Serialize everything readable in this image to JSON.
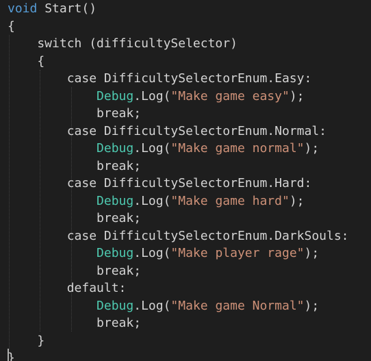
{
  "editor": {
    "lines": [
      {
        "tokens": [
          {
            "t": "void",
            "c": "kw"
          },
          {
            "t": " ",
            "c": "plain"
          },
          {
            "t": "Start",
            "c": "plain"
          },
          {
            "t": "()",
            "c": "plain"
          }
        ]
      },
      {
        "tokens": [
          {
            "t": "{",
            "c": "plain"
          }
        ]
      },
      {
        "tokens": [
          {
            "t": "    switch (difficultySelector)",
            "c": "plain"
          }
        ]
      },
      {
        "tokens": [
          {
            "t": "    {",
            "c": "plain"
          }
        ]
      },
      {
        "tokens": [
          {
            "t": "        case DifficultySelectorEnum.Easy:",
            "c": "plain"
          }
        ]
      },
      {
        "tokens": [
          {
            "t": "            ",
            "c": "plain"
          },
          {
            "t": "Debug",
            "c": "type"
          },
          {
            "t": ".Log(",
            "c": "plain"
          },
          {
            "t": "\"Make game easy\"",
            "c": "str"
          },
          {
            "t": ");",
            "c": "plain"
          }
        ]
      },
      {
        "tokens": [
          {
            "t": "            break;",
            "c": "plain"
          }
        ]
      },
      {
        "tokens": [
          {
            "t": "        case DifficultySelectorEnum.Normal:",
            "c": "plain"
          }
        ]
      },
      {
        "tokens": [
          {
            "t": "            ",
            "c": "plain"
          },
          {
            "t": "Debug",
            "c": "type"
          },
          {
            "t": ".Log(",
            "c": "plain"
          },
          {
            "t": "\"Make game normal\"",
            "c": "str"
          },
          {
            "t": ");",
            "c": "plain"
          }
        ]
      },
      {
        "tokens": [
          {
            "t": "            break;",
            "c": "plain"
          }
        ]
      },
      {
        "tokens": [
          {
            "t": "        case DifficultySelectorEnum.Hard:",
            "c": "plain"
          }
        ]
      },
      {
        "tokens": [
          {
            "t": "            ",
            "c": "plain"
          },
          {
            "t": "Debug",
            "c": "type"
          },
          {
            "t": ".Log(",
            "c": "plain"
          },
          {
            "t": "\"Make game hard\"",
            "c": "str"
          },
          {
            "t": ");",
            "c": "plain"
          }
        ]
      },
      {
        "tokens": [
          {
            "t": "            break;",
            "c": "plain"
          }
        ]
      },
      {
        "tokens": [
          {
            "t": "        case DifficultySelectorEnum.DarkSouls:",
            "c": "plain"
          }
        ]
      },
      {
        "tokens": [
          {
            "t": "            ",
            "c": "plain"
          },
          {
            "t": "Debug",
            "c": "type"
          },
          {
            "t": ".Log(",
            "c": "plain"
          },
          {
            "t": "\"Make player rage\"",
            "c": "str"
          },
          {
            "t": ");",
            "c": "plain"
          }
        ]
      },
      {
        "tokens": [
          {
            "t": "            break;",
            "c": "plain"
          }
        ]
      },
      {
        "tokens": [
          {
            "t": "        default:",
            "c": "plain"
          }
        ]
      },
      {
        "tokens": [
          {
            "t": "            ",
            "c": "plain"
          },
          {
            "t": "Debug",
            "c": "type"
          },
          {
            "t": ".Log(",
            "c": "plain"
          },
          {
            "t": "\"Make game Normal\"",
            "c": "str"
          },
          {
            "t": ");",
            "c": "plain"
          }
        ]
      },
      {
        "tokens": [
          {
            "t": "            break;",
            "c": "plain"
          }
        ]
      },
      {
        "tokens": [
          {
            "t": "    }",
            "c": "plain"
          }
        ]
      },
      {
        "tokens": [
          {
            "t": "}",
            "c": "plain"
          }
        ]
      }
    ]
  },
  "theme": {
    "background": "#1e1e1e",
    "keyword": "#569cd6",
    "method": "#dcdcaa",
    "type": "#4ec9b0",
    "string": "#ce9178",
    "text": "#d4d4d4"
  }
}
